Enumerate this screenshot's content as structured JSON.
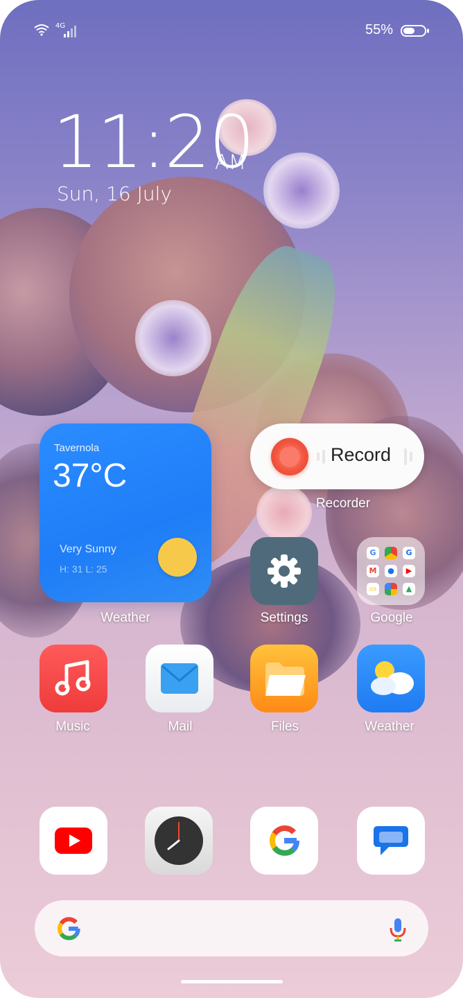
{
  "status_bar": {
    "network_label": "4G",
    "battery_percent": "55%",
    "battery_level": 0.55
  },
  "clock": {
    "time": "11:20",
    "ampm": "AM",
    "date": "Sun, 16 July"
  },
  "weather_widget": {
    "city": "Tavernola",
    "temperature": "37°C",
    "condition": "Very Sunny",
    "high_low": "H: 31   L: 25",
    "label": "Weather",
    "sun_color": "#f7c94a"
  },
  "recorder_widget": {
    "button_label": "Record",
    "label": "Recorder",
    "accent": "#f2553f"
  },
  "apps": {
    "settings": {
      "label": "Settings",
      "icon": "gear-icon"
    },
    "google_folder": {
      "label": "Google",
      "icon": "google-apps-folder-icon"
    },
    "music": {
      "label": "Music",
      "icon": "music-note-icon"
    },
    "mail": {
      "label": "Mail",
      "icon": "envelope-icon"
    },
    "files": {
      "label": "Files",
      "icon": "folder-icon"
    },
    "weather": {
      "label": "Weather",
      "icon": "sun-cloud-icon"
    }
  },
  "dock": {
    "youtube": {
      "icon": "youtube-icon"
    },
    "clock": {
      "icon": "clock-icon"
    },
    "google": {
      "icon": "google-g-icon"
    },
    "messages": {
      "icon": "messages-bubble-icon"
    }
  },
  "search_bar": {
    "left_icon": "google-g-icon",
    "right_icon": "microphone-icon"
  }
}
